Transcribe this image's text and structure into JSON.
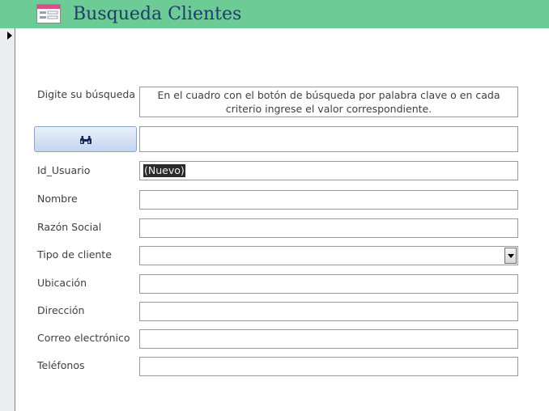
{
  "header": {
    "title": "Busqueda Clientes",
    "icon": "form-icon"
  },
  "search": {
    "label": "Digite su búsqueda",
    "info_text": "En el cuadro con el botón de búsqueda por palabra clave o en cada criterio ingrese el valor correspondiente.",
    "button_icon": "binoculars-icon",
    "input_value": ""
  },
  "fields": {
    "id_usuario": {
      "label": "Id_Usuario",
      "value": "(Nuevo)"
    },
    "nombre": {
      "label": "Nombre",
      "value": ""
    },
    "razon_social": {
      "label": "Razón Social",
      "value": ""
    },
    "tipo_cliente": {
      "label": "Tipo de cliente",
      "value": ""
    },
    "ubicacion": {
      "label": "Ubicación",
      "value": ""
    },
    "direccion": {
      "label": "Dirección",
      "value": ""
    },
    "correo": {
      "label": "Correo electrónico",
      "value": ""
    },
    "telefonos": {
      "label": "Teléfonos",
      "value": ""
    }
  },
  "colors": {
    "header_bg": "#6dcb95",
    "title_text": "#1f3d6b"
  }
}
